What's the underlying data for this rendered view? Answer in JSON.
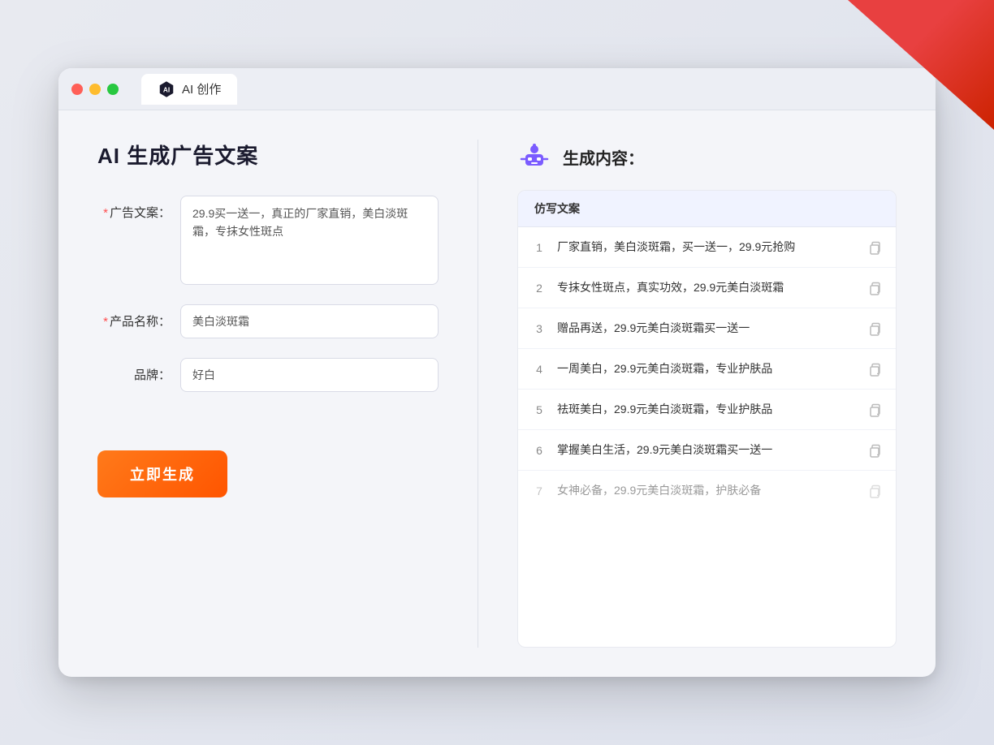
{
  "corner_deco": true,
  "browser": {
    "tab_label": "AI 创作"
  },
  "left_panel": {
    "title": "AI 生成广告文案",
    "fields": [
      {
        "id": "ad_copy",
        "label": "广告文案：",
        "required": true,
        "type": "textarea",
        "value": "29.9买一送一，真正的厂家直销，美白淡斑霜，专抹女性斑点",
        "placeholder": ""
      },
      {
        "id": "product_name",
        "label": "产品名称：",
        "required": true,
        "type": "input",
        "value": "美白淡斑霜",
        "placeholder": ""
      },
      {
        "id": "brand",
        "label": "品牌：",
        "required": false,
        "type": "input",
        "value": "好白",
        "placeholder": ""
      }
    ],
    "generate_btn_label": "立即生成"
  },
  "right_panel": {
    "title": "生成内容：",
    "table_header": "仿写文案",
    "rows": [
      {
        "num": "1",
        "text": "厂家直销，美白淡斑霜，买一送一，29.9元抢购"
      },
      {
        "num": "2",
        "text": "专抹女性斑点，真实功效，29.9元美白淡斑霜"
      },
      {
        "num": "3",
        "text": "赠品再送，29.9元美白淡斑霜买一送一"
      },
      {
        "num": "4",
        "text": "一周美白，29.9元美白淡斑霜，专业护肤品"
      },
      {
        "num": "5",
        "text": "祛斑美白，29.9元美白淡斑霜，专业护肤品"
      },
      {
        "num": "6",
        "text": "掌握美白生活，29.9元美白淡斑霜买一送一"
      },
      {
        "num": "7",
        "text": "女神必备，29.9元美白淡斑霜，护肤必备"
      }
    ]
  }
}
